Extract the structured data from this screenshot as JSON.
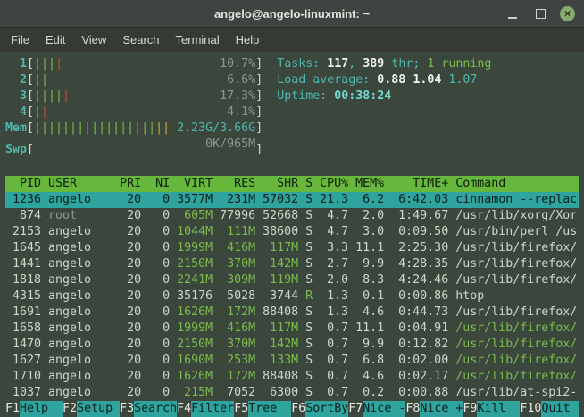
{
  "window": {
    "title": "angelo@angelo-linuxmint: ~",
    "close_glyph": "×"
  },
  "menu": {
    "items": [
      "File",
      "Edit",
      "View",
      "Search",
      "Terminal",
      "Help"
    ]
  },
  "htop": {
    "meters": [
      {
        "id": "cpu1",
        "label": "1",
        "segments": [
          {
            "ch": "|||",
            "cls": "green"
          },
          {
            "ch": "|",
            "cls": "red"
          }
        ],
        "value": "10.7%",
        "value_cls": "gray"
      },
      {
        "id": "cpu2",
        "label": "2",
        "segments": [
          {
            "ch": "||",
            "cls": "green"
          }
        ],
        "value": "6.6%",
        "value_cls": "gray"
      },
      {
        "id": "cpu3",
        "label": "3",
        "segments": [
          {
            "ch": "||||",
            "cls": "green"
          },
          {
            "ch": "|",
            "cls": "red"
          }
        ],
        "value": "17.3%",
        "value_cls": "gray"
      },
      {
        "id": "cpu4",
        "label": "4",
        "segments": [
          {
            "ch": "|",
            "cls": "green"
          },
          {
            "ch": "|",
            "cls": "red"
          }
        ],
        "value": "4.1%",
        "value_cls": "gray"
      },
      {
        "id": "mem",
        "label": "Mem",
        "segments": [
          {
            "ch": "|||||||||||||||||",
            "cls": "green"
          },
          {
            "ch": "||",
            "cls": "yellow"
          }
        ],
        "value": "2.23G/3.66G",
        "value_cls": "cyan"
      },
      {
        "id": "swp",
        "label": "Swp",
        "segments": [],
        "value": "0K/965M",
        "value_cls": "gray"
      }
    ],
    "info_lines": [
      {
        "id": "tasks",
        "segments": [
          {
            "t": "Tasks: ",
            "cls": "cyan"
          },
          {
            "t": "117",
            "cls": "boldwhite"
          },
          {
            "t": ", ",
            "cls": "cyan"
          },
          {
            "t": "389",
            "cls": "boldwhite"
          },
          {
            "t": " thr; ",
            "cls": "cyan"
          },
          {
            "t": "1 running",
            "cls": "green"
          }
        ]
      },
      {
        "id": "load",
        "segments": [
          {
            "t": "Load average: ",
            "cls": "cyan"
          },
          {
            "t": "0.88 ",
            "cls": "boldwhite"
          },
          {
            "t": "1.04 ",
            "cls": "boldwhite"
          },
          {
            "t": "1.07",
            "cls": "cyan"
          }
        ]
      },
      {
        "id": "uptime",
        "segments": [
          {
            "t": "Uptime: ",
            "cls": "cyan"
          },
          {
            "t": "00:38:24",
            "cls": "boldcyan"
          }
        ]
      }
    ],
    "table": {
      "columns": [
        "PID",
        "USER",
        "PRI",
        "NI",
        "VIRT",
        "RES",
        "SHR",
        "S",
        "CPU%",
        "MEM%",
        "TIME+",
        "Command"
      ],
      "rows": [
        {
          "pid": "1236",
          "user": "angelo",
          "pri": "20",
          "ni": "0",
          "virt": "3577M",
          "res": "231M",
          "shr": "57032",
          "s": "S",
          "cpu": "21.3",
          "mem": "6.2",
          "time": "6:42.03",
          "cmd": "cinnamon --replac",
          "selected": true
        },
        {
          "pid": "874",
          "user": "root",
          "pri": "20",
          "ni": "0",
          "virt": "605M",
          "res": "77996",
          "shr": "52668",
          "s": "S",
          "cpu": "4.7",
          "mem": "2.0",
          "time": "1:49.67",
          "cmd": "/usr/lib/xorg/Xor"
        },
        {
          "pid": "2153",
          "user": "angelo",
          "pri": "20",
          "ni": "0",
          "virt": "1044M",
          "res": "111M",
          "shr": "38600",
          "s": "S",
          "cpu": "4.7",
          "mem": "3.0",
          "time": "0:09.50",
          "cmd": "/usr/bin/perl /us"
        },
        {
          "pid": "1645",
          "user": "angelo",
          "pri": "20",
          "ni": "0",
          "virt": "1999M",
          "res": "416M",
          "shr": "117M",
          "s": "S",
          "cpu": "3.3",
          "mem": "11.1",
          "time": "2:25.30",
          "cmd": "/usr/lib/firefox/"
        },
        {
          "pid": "1441",
          "user": "angelo",
          "pri": "20",
          "ni": "0",
          "virt": "2150M",
          "res": "370M",
          "shr": "142M",
          "s": "S",
          "cpu": "2.7",
          "mem": "9.9",
          "time": "4:28.35",
          "cmd": "/usr/lib/firefox/"
        },
        {
          "pid": "1818",
          "user": "angelo",
          "pri": "20",
          "ni": "0",
          "virt": "2241M",
          "res": "309M",
          "shr": "119M",
          "s": "S",
          "cpu": "2.0",
          "mem": "8.3",
          "time": "4:24.46",
          "cmd": "/usr/lib/firefox/"
        },
        {
          "pid": "4315",
          "user": "angelo",
          "pri": "20",
          "ni": "0",
          "virt": "35176",
          "res": "5028",
          "shr": "3744",
          "s": "R",
          "cpu": "1.3",
          "mem": "0.1",
          "time": "0:00.86",
          "cmd": "htop"
        },
        {
          "pid": "1691",
          "user": "angelo",
          "pri": "20",
          "ni": "0",
          "virt": "1626M",
          "res": "172M",
          "shr": "88408",
          "s": "S",
          "cpu": "1.3",
          "mem": "4.6",
          "time": "0:44.73",
          "cmd": "/usr/lib/firefox/"
        },
        {
          "pid": "1658",
          "user": "angelo",
          "pri": "20",
          "ni": "0",
          "virt": "1999M",
          "res": "416M",
          "shr": "117M",
          "s": "S",
          "cpu": "0.7",
          "mem": "11.1",
          "time": "0:04.91",
          "cmd": "/usr/lib/firefox/",
          "thread": true
        },
        {
          "pid": "1470",
          "user": "angelo",
          "pri": "20",
          "ni": "0",
          "virt": "2150M",
          "res": "370M",
          "shr": "142M",
          "s": "S",
          "cpu": "0.7",
          "mem": "9.9",
          "time": "0:12.82",
          "cmd": "/usr/lib/firefox/",
          "thread": true
        },
        {
          "pid": "1627",
          "user": "angelo",
          "pri": "20",
          "ni": "0",
          "virt": "1690M",
          "res": "253M",
          "shr": "133M",
          "s": "S",
          "cpu": "0.7",
          "mem": "6.8",
          "time": "0:02.00",
          "cmd": "/usr/lib/firefox/",
          "thread": true
        },
        {
          "pid": "1710",
          "user": "angelo",
          "pri": "20",
          "ni": "0",
          "virt": "1626M",
          "res": "172M",
          "shr": "88408",
          "s": "S",
          "cpu": "0.7",
          "mem": "4.6",
          "time": "0:02.17",
          "cmd": "/usr/lib/firefox/",
          "thread": true
        },
        {
          "pid": "1037",
          "user": "angelo",
          "pri": "20",
          "ni": "0",
          "virt": "215M",
          "res": "7052",
          "shr": "6300",
          "s": "S",
          "cpu": "0.7",
          "mem": "0.2",
          "time": "0:00.88",
          "cmd": "/usr/lib/at-spi2-"
        }
      ]
    },
    "fkeys": [
      {
        "key": "F1",
        "label": "Help"
      },
      {
        "key": "F2",
        "label": "Setup"
      },
      {
        "key": "F3",
        "label": "Search"
      },
      {
        "key": "F4",
        "label": "Filter"
      },
      {
        "key": "F5",
        "label": "Tree"
      },
      {
        "key": "F6",
        "label": "SortBy"
      },
      {
        "key": "F7",
        "label": "Nice -"
      },
      {
        "key": "F8",
        "label": "Nice +"
      },
      {
        "key": "F9",
        "label": "Kill"
      },
      {
        "key": "F10",
        "label": "Quit"
      }
    ],
    "colors": {
      "terminal_bg": "#3b463d",
      "header_bg": "#67b73c",
      "selection_bg": "#2fa39e",
      "accent_cyan": "#4fb8ac",
      "accent_green": "#7cbd4a",
      "accent_red": "#c84b3d"
    }
  }
}
